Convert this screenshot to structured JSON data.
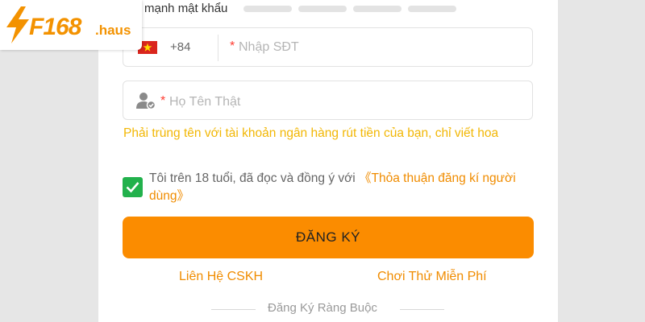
{
  "logo": {
    "brand": "F168",
    "domain": ".haus"
  },
  "password_strength": {
    "label": "mạnh mật khẩu",
    "levels_filled": 0,
    "levels_total": 4
  },
  "phone": {
    "country_code": "+84",
    "flag_icon": "vietnam-flag-icon",
    "required_mark": "*",
    "placeholder": "Nhập SĐT"
  },
  "real_name": {
    "icon": "user-check-icon",
    "required_mark": "*",
    "placeholder": "Họ Tên Thật",
    "hint": "Phải trùng tên với tài khoản ngân hàng rút tiền của bạn, chỉ viết hoa"
  },
  "agreement": {
    "checked": true,
    "text": "Tôi trên 18 tuổi, đã đọc và đồng ý với ",
    "link": "《Thỏa thuận đăng kí người dùng》"
  },
  "register_button": "ĐĂNG KÝ",
  "links": {
    "contact": "Liên Hệ CSKH",
    "free_trial": "Chơi Thử Miễn Phí"
  },
  "binding_section": "Đăng Ký Ràng Buộc",
  "colors": {
    "accent": "#fb8c00",
    "link": "#f08c00",
    "hint": "#f2b705",
    "check": "#22b14c",
    "required": "#ff3b30"
  }
}
